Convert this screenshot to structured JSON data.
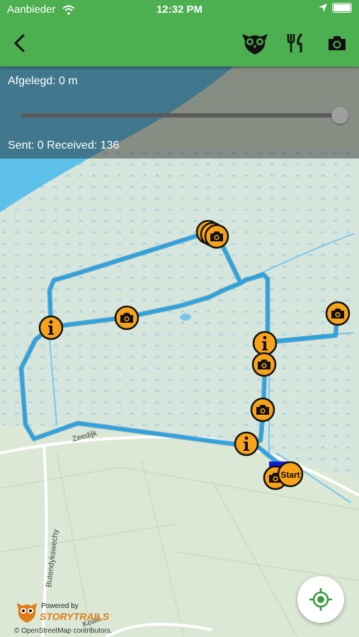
{
  "status_bar": {
    "carrier": "Aanbieder",
    "time": "12:32 PM"
  },
  "nav": {
    "icons": [
      "back-chevron-icon",
      "owl-icon",
      "fork-knife-icon",
      "camera-icon"
    ]
  },
  "overlay": {
    "distance": "Afgelegd: 0 m",
    "progress": 1.0,
    "counts": "Sent: 0 Received: 136"
  },
  "map": {
    "street_labels": [
      "Zeedijk",
      "Butendykswechy",
      "Koaik"
    ],
    "start_label": "Start",
    "powered_by": "Powered by",
    "brand": "STORYTRAILS",
    "attribution": "© OpenStreetMap contributors."
  },
  "colors": {
    "navbar": "#4caf50",
    "route": "#2ba3e2",
    "marker": "#f7a21b",
    "water": "#5cc0e8"
  }
}
